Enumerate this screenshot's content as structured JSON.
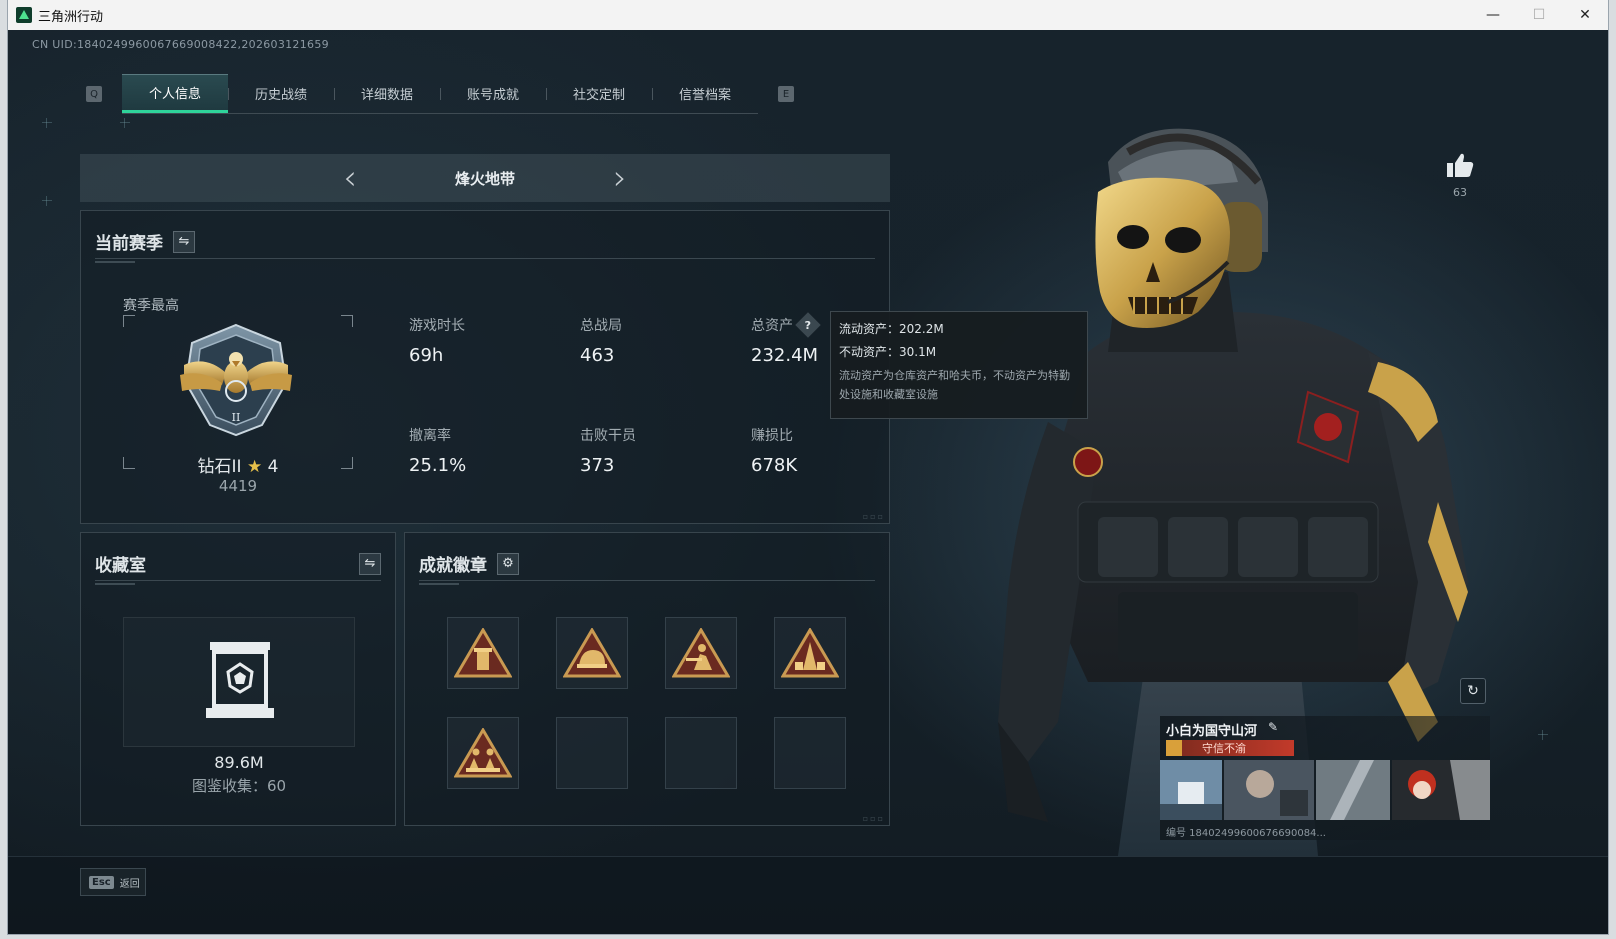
{
  "window": {
    "title": "三角洲行动",
    "minimize": "—",
    "maximize": "☐",
    "close": "✕"
  },
  "uid_text": "CN UID:1840249960067669008422,202603121659",
  "tabs": {
    "left_key": "Q",
    "right_key": "E",
    "items": [
      {
        "label": "个人信息",
        "active": true
      },
      {
        "label": "历史战绩",
        "active": false
      },
      {
        "label": "详细数据",
        "active": false
      },
      {
        "label": "账号成就",
        "active": false
      },
      {
        "label": "社交定制",
        "active": false
      },
      {
        "label": "信誉档案",
        "active": false
      }
    ]
  },
  "mode": {
    "prev": "‹",
    "title": "烽火地带",
    "next": "›"
  },
  "season": {
    "title": "当前赛季",
    "swap_icon": "⇋",
    "best_label": "赛季最高",
    "rank_name": "钻石II",
    "rank_star": "★",
    "rank_stars_count": "4",
    "rank_score": "4419",
    "stats": [
      {
        "label": "游戏时长",
        "value": "69h"
      },
      {
        "label": "总战局",
        "value": "463"
      },
      {
        "label": "总资产",
        "value": "232.4M",
        "help": "?"
      },
      {
        "label": "撤离率",
        "value": "25.1%"
      },
      {
        "label": "击败干员",
        "value": "373"
      },
      {
        "label": "赚损比",
        "value": "678K"
      }
    ]
  },
  "tooltip": {
    "liquid": "流动资产：202.2M",
    "fixed": "不动资产：30.1M",
    "desc": "流动资产为仓库资产和哈夫币，不动资产为特勤处设施和收藏室设施"
  },
  "collection": {
    "title": "收藏室",
    "swap_icon": "⇋",
    "value": "89.6M",
    "count_text": "图鉴收集：60"
  },
  "achievements": {
    "title": "成就徽章",
    "settings_icon": "⚙",
    "badges": [
      "badge-1",
      "badge-2",
      "badge-3",
      "badge-4",
      "badge-5",
      "",
      "",
      ""
    ]
  },
  "footer": {
    "esc_key": "Esc",
    "esc_label": "返回"
  },
  "profile": {
    "like_count": "63",
    "player_name": "小白为国守山河",
    "edit_icon": "✎",
    "reputation": "守信不渝",
    "player_id": "编号 18402499600676690084...",
    "refresh_icon": "↻"
  },
  "colors": {
    "accent": "#2fd39a",
    "gold": "#c9a24a",
    "reputation_red": "#c23a2a"
  }
}
